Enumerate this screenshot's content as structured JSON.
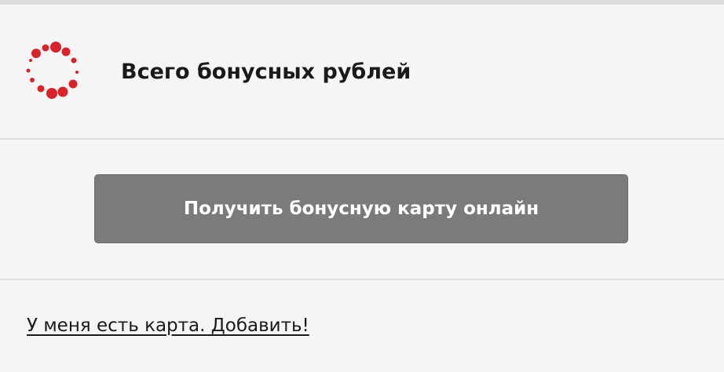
{
  "header": {
    "title": "Всего бонусных рублей",
    "logo_icon": "bonus-dots-logo-icon",
    "logo_color": "#d8232a"
  },
  "actions": {
    "bonus_button_label": "Получить бонусную карту онлайн",
    "bonus_button_color": "#7a7b7c",
    "add_card_link_label": "У меня есть карта. Добавить!"
  }
}
